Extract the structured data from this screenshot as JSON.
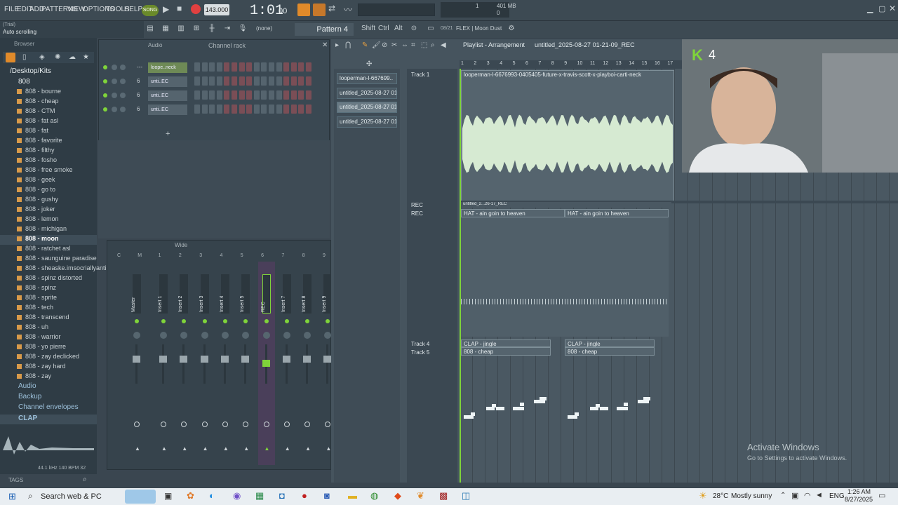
{
  "menu": [
    "FILE",
    "EDIT",
    "ADD",
    "PATTERNS",
    "VIEW",
    "OPTIONS",
    "TOOLS",
    "HELP"
  ],
  "song_toggle": "SONG",
  "tempo": "143.000",
  "time": "1:01",
  "time_sub": "00",
  "memory": "401 MB",
  "cpu_top": "1",
  "cpu_bottom": "0",
  "hint": {
    "line1": "(Trial)",
    "line2": "Auto scrolling"
  },
  "pattern_selector": "Pattern 4",
  "none_label": "(none)",
  "mod_keys": [
    "Shift",
    "Ctrl",
    "Alt"
  ],
  "preset": "FLEX | Moon Dust",
  "preset_num": "08/21",
  "browser": {
    "title": "Browser",
    "path": "/Desktop/Kits",
    "folder": "808",
    "items": [
      "808 - bourne",
      "808 - cheap",
      "808 - CTM",
      "808 - fat asl",
      "808 - fat",
      "808 - favorite",
      "808 - filthy",
      "808 - fosho",
      "808 - free smoke",
      "808 - geek",
      "808 - go to",
      "808 - gushy",
      "808 - joker",
      "808 - lemon",
      "808 - michigan",
      "808 - moon",
      "808 - ratchet asl",
      "808 - saunguine paradise",
      "808 - sheaske.imsocriallyanti",
      "808 - spinz distorted",
      "808 - spinz",
      "808 - sprite",
      "808 - tech",
      "808 - transcend",
      "808 - uh",
      "808 - warrior",
      "808 - yo pierre",
      "808 - zay declicked",
      "808 - zay hard",
      "808 - zay"
    ],
    "selected_item": "808 - moon",
    "folders_bottom": [
      "Audio",
      "Backup",
      "Channel envelopes",
      "CLAP"
    ],
    "waveform_info": "44.1 kHz 140 BPM 32",
    "tags": "TAGS"
  },
  "channel_rack": {
    "title": "Channel rack",
    "filter": "Audio",
    "channels": [
      {
        "num": "---",
        "name": "loope..neck"
      },
      {
        "num": "6",
        "name": "unti..EC"
      },
      {
        "num": "6",
        "name": "unti..EC"
      },
      {
        "num": "6",
        "name": "unti..EC"
      }
    ]
  },
  "mixer": {
    "mode": "Wide",
    "numbers": [
      "C",
      "M",
      "1",
      "2",
      "3",
      "4",
      "5",
      "6",
      "7",
      "8",
      "9"
    ],
    "strips": [
      "Master",
      "Insert 1",
      "Insert 2",
      "Insert 3",
      "Insert 4",
      "Insert 5",
      "REC",
      "Insert 7",
      "Insert 8",
      "Insert 9"
    ]
  },
  "patterns": [
    "looperman-l-667699..",
    "untitled_2025-08-27 01-..",
    "untitled_2025-08-27 01-..",
    "untitled_2025-08-27 01-.."
  ],
  "playlist": {
    "title": "Playlist - Arrangement",
    "file": "untitled_2025-08-27 01-21-09_REC",
    "ruler": [
      "1",
      "2",
      "3",
      "4",
      "5",
      "6",
      "7",
      "8",
      "9",
      "10",
      "11",
      "12",
      "13",
      "14",
      "15",
      "16",
      "17"
    ],
    "tracks": [
      "Track 1",
      "REC",
      "REC",
      "Track 4",
      "Track 5"
    ],
    "clips": {
      "sample": "looperman-l-6676993-0405405-future-x-travis-scott-x-playboi-carti-neck",
      "rec_label": "untitled_2...26-17_REC",
      "hat1": "HAT - ain goin to heaven",
      "hat2": "HAT - ain goin to heaven",
      "clap1": "CLAP - jingle",
      "clap2": "CLAP - jingle",
      "b808_1": "808 - cheap",
      "b808_2": "808 - cheap"
    }
  },
  "watermark": {
    "line1": "Activate Windows",
    "line2": "Go to Settings to activate Windows."
  },
  "webcam_counter": "4",
  "taskbar": {
    "search": "Search web & PC",
    "weather": "28°C",
    "weather_text": "Mostly sunny",
    "lang": "ENG",
    "time": "1:26 AM",
    "date": "8/27/2025"
  },
  "colors": {
    "accent_green": "#7fd43a",
    "rec_red": "#e04040",
    "clip_bg": "#55646e",
    "waveform": "#d6ead2"
  }
}
